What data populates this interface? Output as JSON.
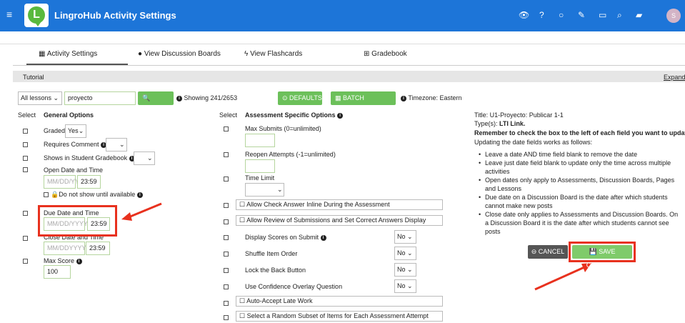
{
  "header": {
    "menu_icon": "hamburger-icon",
    "logo_letter": "L",
    "title": "LingroHub Activity Settings",
    "avatar_initial": "S",
    "icons": [
      "eye-icon",
      "help-icon",
      "chat-icon",
      "edit-icon",
      "calendar-icon",
      "search-icon",
      "notebook-icon"
    ]
  },
  "tabs": [
    {
      "label": "Activity Settings",
      "icon": "calendar-icon"
    },
    {
      "label": "View Discussion Boards",
      "icon": "comments-icon"
    },
    {
      "label": "View Flashcards",
      "icon": "bolt-icon"
    },
    {
      "label": "Gradebook",
      "icon": "table-icon"
    }
  ],
  "tutorial": {
    "label": "Tutorial",
    "expand": "Expand"
  },
  "filter": {
    "lessons_select": "All lessons",
    "search_value": "proyecto",
    "filter_button": "FILTER",
    "showing": "Showing 241/2653",
    "defaults_button": "DEFAULTS",
    "batch_button": "BATCH SETTINGS",
    "timezone": "Timezone: Eastern"
  },
  "general": {
    "select_header": "Select",
    "header": "General Options",
    "graded_label": "Graded",
    "graded_value": "Yes",
    "requires_comment_label": "Requires Comment",
    "shows_gradebook_label": "Shows in Student Gradebook",
    "open_label": "Open Date and Time",
    "open_date_placeholder": "MM/DD/YYYY",
    "open_time": "23:59",
    "do_not_show": "Do not show until available",
    "due_label": "Due Date and Time",
    "due_date_placeholder": "MM/DD/YYYY",
    "due_time": "23:59",
    "close_label": "Close Date and Time",
    "close_date_placeholder": "MM/DDYYYY",
    "close_time": "23:59",
    "max_score_label": "Max Score",
    "max_score_value": "100"
  },
  "assessment": {
    "select_header": "Select",
    "header": "Assessment Specific Options",
    "max_submits": "Max Submits (0=unlimited)",
    "reopen": "Reopen Attempts (-1=unlimited)",
    "time_limit": "Time Limit",
    "check_answer": "Allow Check Answer Inline During the Assessment",
    "allow_review": "Allow Review of Submissions and Set Correct Answers Display",
    "display_scores": "Display Scores on Submit",
    "shuffle": "Shuffle Item Order",
    "lock_back": "Lock the Back Button",
    "confidence": "Use Confidence Overlay Question",
    "auto_accept": "Auto-Accept Late Work",
    "random_subset": "Select a Random Subset of Items for Each Assessment Attempt",
    "no_value": "No"
  },
  "info": {
    "title": "Title: U1-Proyecto: Publicar 1-1",
    "type_label": "Type(s): ",
    "type_value": "LTI Link.",
    "remember": "Remember to check the box to the left of each field you want to update!",
    "updating": "Updating the date fields works as follows:",
    "notes": [
      "Leave a date AND time field blank to remove the date",
      "Leave just date field blank to update only the time across multiple activities",
      "Open dates only apply to Assessments, Discussion Boards, Pages and Lessons",
      "Due date on a Discussion Board is the date after which students cannot make new posts",
      "Close date only applies to Assessments and Discussion Boards. On a Discussion Board it is the date after which students cannot see posts"
    ],
    "cancel_button": "CANCEL",
    "save_button": "SAVE CHANGES"
  },
  "colors": {
    "header_bg": "#1d75d8",
    "accent_green": "#6cc05a",
    "highlight_red": "#e8311e"
  }
}
